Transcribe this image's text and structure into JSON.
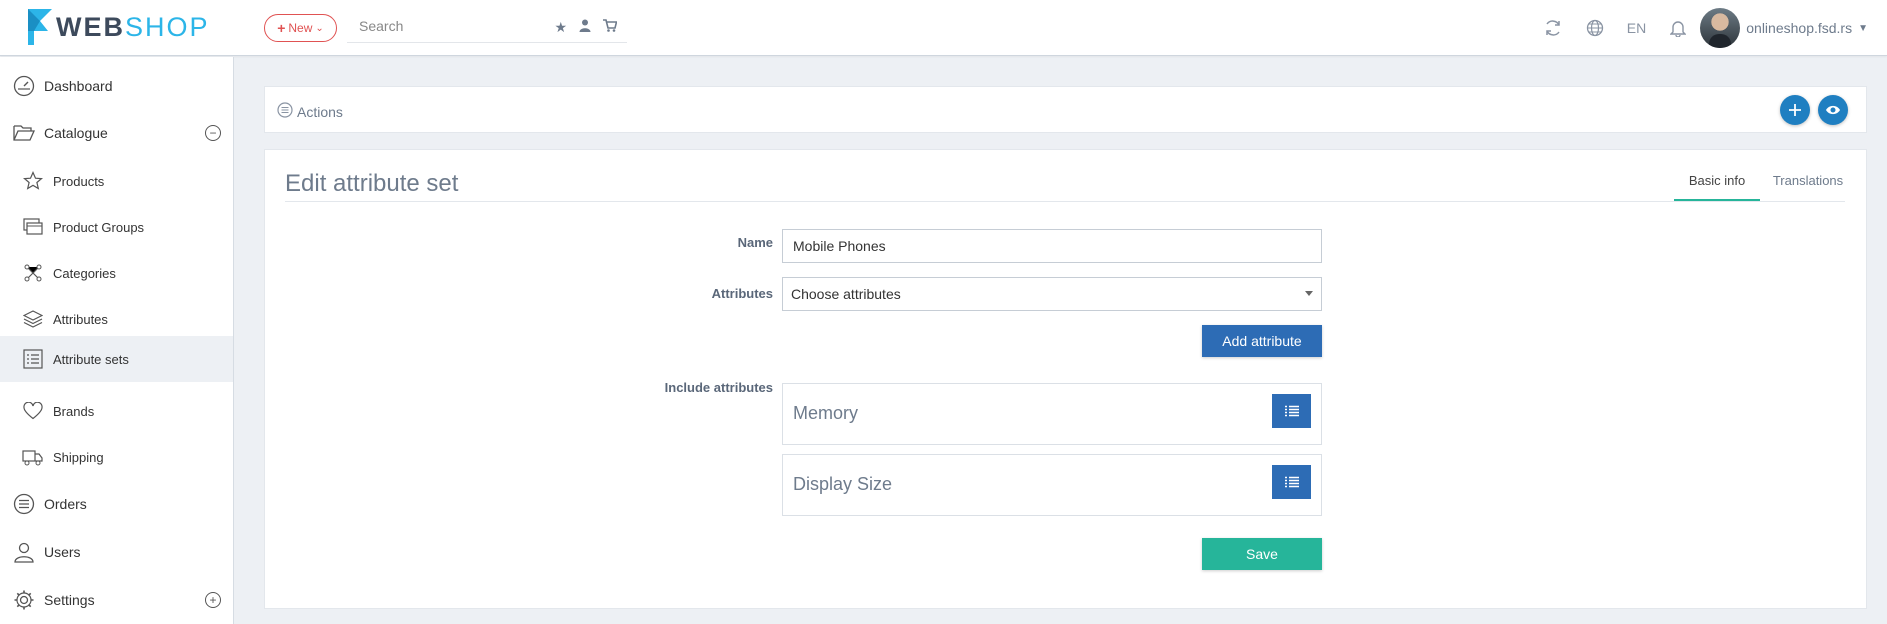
{
  "brand": {
    "name_part1": "WEB",
    "name_part2": "SHOP"
  },
  "topbar": {
    "new_label": "New",
    "search_placeholder": "Search",
    "language": "EN",
    "user_label": "onlineshop.fsd.rs"
  },
  "sidebar": {
    "items": [
      {
        "label": "Dashboard"
      },
      {
        "label": "Catalogue"
      },
      {
        "label": "Products"
      },
      {
        "label": "Product Groups"
      },
      {
        "label": "Categories"
      },
      {
        "label": "Attributes"
      },
      {
        "label": "Attribute sets"
      },
      {
        "label": "Brands"
      },
      {
        "label": "Shipping"
      },
      {
        "label": "Orders"
      },
      {
        "label": "Users"
      },
      {
        "label": "Settings"
      }
    ],
    "active": "Attribute sets"
  },
  "actions": {
    "label": "Actions"
  },
  "form": {
    "title": "Edit attribute set",
    "tabs": [
      {
        "label": "Basic info"
      },
      {
        "label": "Translations"
      }
    ],
    "name_label": "Name",
    "name_value": "Mobile Phones",
    "attributes_label": "Attributes",
    "attributes_value": "Choose attributes",
    "add_attribute_label": "Add attribute",
    "include_label": "Include attributes",
    "included": [
      {
        "name": "Memory"
      },
      {
        "name": "Display Size"
      }
    ],
    "save_label": "Save"
  },
  "colors": {
    "primary": "#2d6cb5",
    "accent_round": "#1f7fc1",
    "success": "#26b59a",
    "danger": "#e05252",
    "brand_blue": "#2cb5e8"
  }
}
